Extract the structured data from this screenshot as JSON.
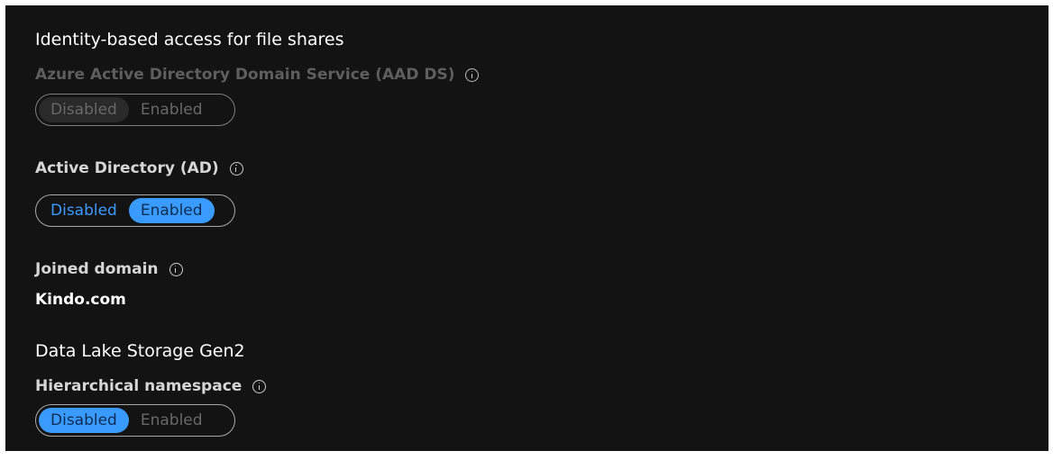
{
  "identity_section": {
    "title": "Identity-based access for file shares",
    "aadds": {
      "label": "Azure Active Directory Domain Service (AAD DS)",
      "options": [
        "Disabled",
        "Enabled"
      ],
      "selected": "Disabled",
      "enabled_control": false
    },
    "ad": {
      "label": "Active Directory (AD)",
      "options": [
        "Disabled",
        "Enabled"
      ],
      "selected": "Enabled",
      "enabled_control": true
    },
    "joined_domain": {
      "label": "Joined domain",
      "value": "Kindo.com"
    }
  },
  "datalake_section": {
    "title": "Data Lake Storage Gen2",
    "hierarchical_namespace": {
      "label": "Hierarchical namespace",
      "options": [
        "Disabled",
        "Enabled"
      ],
      "selected": "Disabled",
      "enabled_control": true
    }
  },
  "colors": {
    "background": "#141314",
    "accent": "#3a9bff",
    "dim_text": "#5e5e5e"
  },
  "icons": [
    "info-icon"
  ]
}
